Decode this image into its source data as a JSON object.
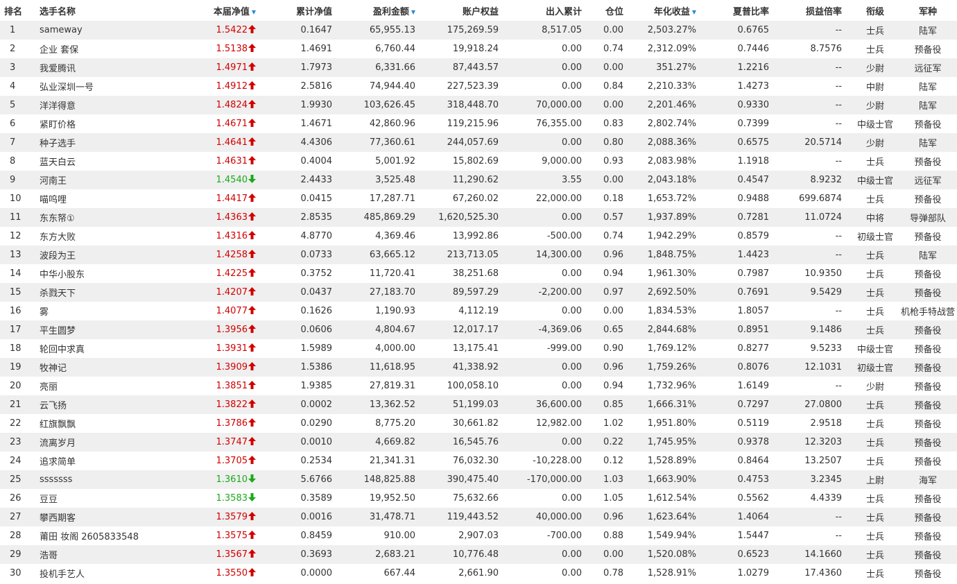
{
  "headers": {
    "rank": "排名",
    "name": "选手名称",
    "nav": "本届净值",
    "cum_nav": "累计净值",
    "profit": "盈利金额",
    "equity": "账户权益",
    "flow": "出入累计",
    "position": "仓位",
    "annual": "年化收益",
    "sharpe": "夏普比率",
    "ratio": "损益倍率",
    "mil_rank": "衔级",
    "branch": "军种"
  },
  "sort_indicator": "▼",
  "colors": {
    "up": "#d10000",
    "down": "#1aaa1a",
    "sort": "#2a8ad4",
    "alt_row": "#efefef"
  },
  "rows": [
    {
      "rank": "1",
      "name": "sameway",
      "nav": "1.5422",
      "dir": "up",
      "cum": "0.1647",
      "profit": "65,955.13",
      "equity": "175,269.59",
      "flow": "8,517.05",
      "pos": "0.00",
      "annual": "2,503.27%",
      "sharpe": "0.6765",
      "ratio": "--",
      "mil": "士兵",
      "branch": "陆军"
    },
    {
      "rank": "2",
      "name": "企业 套保",
      "nav": "1.5138",
      "dir": "up",
      "cum": "1.4691",
      "profit": "6,760.44",
      "equity": "19,918.24",
      "flow": "0.00",
      "pos": "0.74",
      "annual": "2,312.09%",
      "sharpe": "0.7446",
      "ratio": "8.7576",
      "mil": "士兵",
      "branch": "预备役"
    },
    {
      "rank": "3",
      "name": "我爱腾讯",
      "nav": "1.4971",
      "dir": "up",
      "cum": "1.7973",
      "profit": "6,331.66",
      "equity": "87,443.57",
      "flow": "0.00",
      "pos": "0.00",
      "annual": "351.27%",
      "sharpe": "1.2216",
      "ratio": "--",
      "mil": "少尉",
      "branch": "远征军"
    },
    {
      "rank": "4",
      "name": "弘业深圳一号",
      "nav": "1.4912",
      "dir": "up",
      "cum": "2.5816",
      "profit": "74,944.40",
      "equity": "227,523.39",
      "flow": "0.00",
      "pos": "0.84",
      "annual": "2,210.33%",
      "sharpe": "1.4273",
      "ratio": "--",
      "mil": "中尉",
      "branch": "陆军"
    },
    {
      "rank": "5",
      "name": "洋洋得意",
      "nav": "1.4824",
      "dir": "up",
      "cum": "1.9930",
      "profit": "103,626.45",
      "equity": "318,448.70",
      "flow": "70,000.00",
      "pos": "0.00",
      "annual": "2,201.46%",
      "sharpe": "0.9330",
      "ratio": "--",
      "mil": "少尉",
      "branch": "陆军"
    },
    {
      "rank": "6",
      "name": "紧盯价格",
      "nav": "1.4671",
      "dir": "up",
      "cum": "1.4671",
      "profit": "42,860.96",
      "equity": "119,215.96",
      "flow": "76,355.00",
      "pos": "0.83",
      "annual": "2,802.74%",
      "sharpe": "0.7399",
      "ratio": "--",
      "mil": "中级士官",
      "branch": "预备役"
    },
    {
      "rank": "7",
      "name": "种子选手",
      "nav": "1.4641",
      "dir": "up",
      "cum": "4.4306",
      "profit": "77,360.61",
      "equity": "244,057.69",
      "flow": "0.00",
      "pos": "0.80",
      "annual": "2,088.36%",
      "sharpe": "0.6575",
      "ratio": "20.5714",
      "mil": "少尉",
      "branch": "陆军"
    },
    {
      "rank": "8",
      "name": "蓝天白云",
      "nav": "1.4631",
      "dir": "up",
      "cum": "0.4004",
      "profit": "5,001.92",
      "equity": "15,802.69",
      "flow": "9,000.00",
      "pos": "0.93",
      "annual": "2,083.98%",
      "sharpe": "1.1918",
      "ratio": "--",
      "mil": "士兵",
      "branch": "预备役"
    },
    {
      "rank": "9",
      "name": "河南王",
      "nav": "1.4540",
      "dir": "down",
      "cum": "2.4433",
      "profit": "3,525.48",
      "equity": "11,290.62",
      "flow": "3.55",
      "pos": "0.00",
      "annual": "2,043.18%",
      "sharpe": "0.4547",
      "ratio": "8.9232",
      "mil": "中级士官",
      "branch": "远征军"
    },
    {
      "rank": "10",
      "name": "喵呜哩",
      "nav": "1.4417",
      "dir": "up",
      "cum": "0.0415",
      "profit": "17,287.71",
      "equity": "67,260.02",
      "flow": "22,000.00",
      "pos": "0.18",
      "annual": "1,653.72%",
      "sharpe": "0.9488",
      "ratio": "699.6874",
      "mil": "士兵",
      "branch": "预备役"
    },
    {
      "rank": "11",
      "name": "东东帑①",
      "nav": "1.4363",
      "dir": "up",
      "cum": "2.8535",
      "profit": "485,869.29",
      "equity": "1,620,525.30",
      "flow": "0.00",
      "pos": "0.57",
      "annual": "1,937.89%",
      "sharpe": "0.7281",
      "ratio": "11.0724",
      "mil": "中将",
      "branch": "导弹部队"
    },
    {
      "rank": "12",
      "name": "东方大败",
      "nav": "1.4316",
      "dir": "up",
      "cum": "4.8770",
      "profit": "4,369.46",
      "equity": "13,992.86",
      "flow": "-500.00",
      "pos": "0.74",
      "annual": "1,942.29%",
      "sharpe": "0.8579",
      "ratio": "--",
      "mil": "初级士官",
      "branch": "预备役"
    },
    {
      "rank": "13",
      "name": "波段为王",
      "nav": "1.4258",
      "dir": "up",
      "cum": "0.0733",
      "profit": "63,665.12",
      "equity": "213,713.05",
      "flow": "14,300.00",
      "pos": "0.96",
      "annual": "1,848.75%",
      "sharpe": "1.4423",
      "ratio": "--",
      "mil": "士兵",
      "branch": "陆军"
    },
    {
      "rank": "14",
      "name": "中华小股东",
      "nav": "1.4225",
      "dir": "up",
      "cum": "0.3752",
      "profit": "11,720.41",
      "equity": "38,251.68",
      "flow": "0.00",
      "pos": "0.94",
      "annual": "1,961.30%",
      "sharpe": "0.7987",
      "ratio": "10.9350",
      "mil": "士兵",
      "branch": "预备役"
    },
    {
      "rank": "15",
      "name": "杀戮天下",
      "nav": "1.4207",
      "dir": "up",
      "cum": "0.0437",
      "profit": "27,183.70",
      "equity": "89,597.29",
      "flow": "-2,200.00",
      "pos": "0.97",
      "annual": "2,692.50%",
      "sharpe": "0.7691",
      "ratio": "9.5429",
      "mil": "士兵",
      "branch": "预备役"
    },
    {
      "rank": "16",
      "name": "雾",
      "nav": "1.4077",
      "dir": "up",
      "cum": "0.1626",
      "profit": "1,190.93",
      "equity": "4,112.19",
      "flow": "0.00",
      "pos": "0.00",
      "annual": "1,834.53%",
      "sharpe": "1.8057",
      "ratio": "--",
      "mil": "士兵",
      "branch": "机枪手特战营"
    },
    {
      "rank": "17",
      "name": "平生圆梦",
      "nav": "1.3956",
      "dir": "up",
      "cum": "0.0606",
      "profit": "4,804.67",
      "equity": "12,017.17",
      "flow": "-4,369.06",
      "pos": "0.65",
      "annual": "2,844.68%",
      "sharpe": "0.8951",
      "ratio": "9.1486",
      "mil": "士兵",
      "branch": "预备役"
    },
    {
      "rank": "18",
      "name": "轮回中求真",
      "nav": "1.3931",
      "dir": "up",
      "cum": "1.5989",
      "profit": "4,000.00",
      "equity": "13,175.41",
      "flow": "-999.00",
      "pos": "0.90",
      "annual": "1,769.12%",
      "sharpe": "0.8277",
      "ratio": "9.5233",
      "mil": "中级士官",
      "branch": "预备役"
    },
    {
      "rank": "19",
      "name": "牧神记",
      "nav": "1.3909",
      "dir": "up",
      "cum": "1.5386",
      "profit": "11,618.95",
      "equity": "41,338.92",
      "flow": "0.00",
      "pos": "0.96",
      "annual": "1,759.26%",
      "sharpe": "0.8076",
      "ratio": "12.1031",
      "mil": "初级士官",
      "branch": "预备役"
    },
    {
      "rank": "20",
      "name": "亮丽",
      "nav": "1.3851",
      "dir": "up",
      "cum": "1.9385",
      "profit": "27,819.31",
      "equity": "100,058.10",
      "flow": "0.00",
      "pos": "0.94",
      "annual": "1,732.96%",
      "sharpe": "1.6149",
      "ratio": "--",
      "mil": "少尉",
      "branch": "预备役"
    },
    {
      "rank": "21",
      "name": "云飞扬",
      "nav": "1.3822",
      "dir": "up",
      "cum": "0.0002",
      "profit": "13,362.52",
      "equity": "51,199.03",
      "flow": "36,600.00",
      "pos": "0.85",
      "annual": "1,666.31%",
      "sharpe": "0.7297",
      "ratio": "27.0800",
      "mil": "士兵",
      "branch": "预备役"
    },
    {
      "rank": "22",
      "name": "红旗飘飘",
      "nav": "1.3786",
      "dir": "up",
      "cum": "0.0290",
      "profit": "8,775.20",
      "equity": "30,661.82",
      "flow": "12,982.00",
      "pos": "1.02",
      "annual": "1,951.80%",
      "sharpe": "0.5119",
      "ratio": "2.9518",
      "mil": "士兵",
      "branch": "预备役"
    },
    {
      "rank": "23",
      "name": "流离岁月",
      "nav": "1.3747",
      "dir": "up",
      "cum": "0.0010",
      "profit": "4,669.82",
      "equity": "16,545.76",
      "flow": "0.00",
      "pos": "0.22",
      "annual": "1,745.95%",
      "sharpe": "0.9378",
      "ratio": "12.3203",
      "mil": "士兵",
      "branch": "预备役"
    },
    {
      "rank": "24",
      "name": "追求简单",
      "nav": "1.3705",
      "dir": "up",
      "cum": "0.2534",
      "profit": "21,341.31",
      "equity": "76,032.30",
      "flow": "-10,228.00",
      "pos": "0.12",
      "annual": "1,528.89%",
      "sharpe": "0.8464",
      "ratio": "13.2507",
      "mil": "士兵",
      "branch": "预备役"
    },
    {
      "rank": "25",
      "name": "sssssss",
      "nav": "1.3610",
      "dir": "down",
      "cum": "5.6766",
      "profit": "148,825.88",
      "equity": "390,475.40",
      "flow": "-170,000.00",
      "pos": "1.03",
      "annual": "1,663.90%",
      "sharpe": "0.4753",
      "ratio": "3.2345",
      "mil": "上尉",
      "branch": "海军"
    },
    {
      "rank": "26",
      "name": "豆豆",
      "nav": "1.3583",
      "dir": "down",
      "cum": "0.3589",
      "profit": "19,952.50",
      "equity": "75,632.66",
      "flow": "0.00",
      "pos": "1.05",
      "annual": "1,612.54%",
      "sharpe": "0.5562",
      "ratio": "4.4339",
      "mil": "士兵",
      "branch": "预备役"
    },
    {
      "rank": "27",
      "name": "攀西期客",
      "nav": "1.3579",
      "dir": "up",
      "cum": "0.0016",
      "profit": "31,478.71",
      "equity": "119,443.52",
      "flow": "40,000.00",
      "pos": "0.96",
      "annual": "1,623.64%",
      "sharpe": "1.4064",
      "ratio": "--",
      "mil": "士兵",
      "branch": "预备役"
    },
    {
      "rank": "28",
      "name": "莆田 妆阁 2605833548",
      "nav": "1.3575",
      "dir": "up",
      "cum": "0.8459",
      "profit": "910.00",
      "equity": "2,907.03",
      "flow": "-700.00",
      "pos": "0.88",
      "annual": "1,549.94%",
      "sharpe": "1.5447",
      "ratio": "--",
      "mil": "士兵",
      "branch": "预备役"
    },
    {
      "rank": "29",
      "name": "浩哥",
      "nav": "1.3567",
      "dir": "up",
      "cum": "0.3693",
      "profit": "2,683.21",
      "equity": "10,776.48",
      "flow": "0.00",
      "pos": "0.00",
      "annual": "1,520.08%",
      "sharpe": "0.6523",
      "ratio": "14.1660",
      "mil": "士兵",
      "branch": "预备役"
    },
    {
      "rank": "30",
      "name": "投机手艺人",
      "nav": "1.3550",
      "dir": "up",
      "cum": "0.0000",
      "profit": "667.44",
      "equity": "2,661.90",
      "flow": "0.00",
      "pos": "0.78",
      "annual": "1,528.91%",
      "sharpe": "1.0279",
      "ratio": "17.4360",
      "mil": "士兵",
      "branch": "预备役"
    }
  ]
}
